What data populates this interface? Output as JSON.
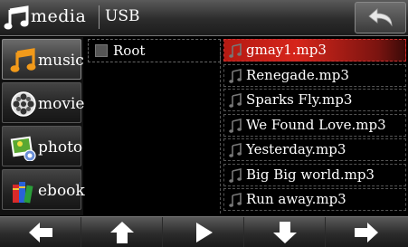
{
  "header": {
    "app_name": "media",
    "source": "USB",
    "back_icon": "return-arrow-icon"
  },
  "sidebar": {
    "items": [
      {
        "label": "music",
        "icon": "music-note-icon",
        "active": true
      },
      {
        "label": "movie",
        "icon": "film-reel-icon",
        "active": false
      },
      {
        "label": "photo",
        "icon": "photo-icon",
        "active": false
      },
      {
        "label": "ebook",
        "icon": "books-icon",
        "active": false
      }
    ]
  },
  "folders": {
    "items": [
      {
        "label": "Root",
        "icon": "folder-icon"
      }
    ]
  },
  "files": {
    "selected_index": 0,
    "items": [
      {
        "name": "gmay1.mp3"
      },
      {
        "name": "Renegade.mp3"
      },
      {
        "name": "Sparks Fly.mp3"
      },
      {
        "name": "We Found Love.mp3"
      },
      {
        "name": "Yesterday.mp3"
      },
      {
        "name": "Big Big world.mp3"
      },
      {
        "name": "Run away.mp3"
      }
    ]
  },
  "bottombar": {
    "buttons": [
      {
        "icon": "arrow-left-icon"
      },
      {
        "icon": "arrow-up-icon"
      },
      {
        "icon": "play-icon"
      },
      {
        "icon": "arrow-down-icon"
      },
      {
        "icon": "arrow-right-icon"
      }
    ]
  },
  "colors": {
    "selection": "#d6251b",
    "accent_orange": "#f29a1a"
  }
}
